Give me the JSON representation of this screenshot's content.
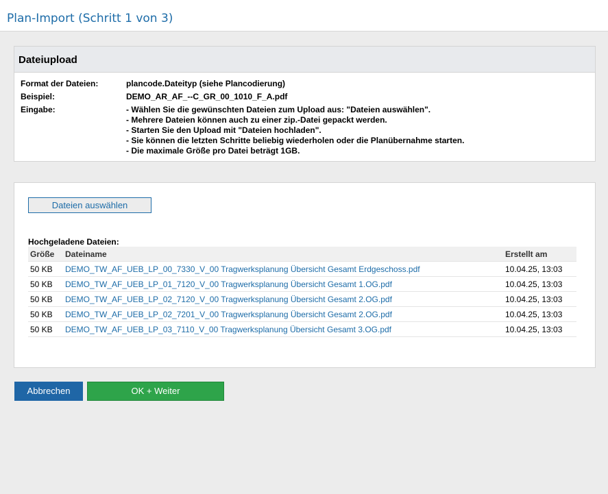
{
  "page": {
    "title": "Plan-Import (Schritt 1 von 3)"
  },
  "info_panel": {
    "title": "Dateiupload",
    "rows": [
      {
        "label": "Format der Dateien:",
        "value": "plancode.Dateityp (siehe Plancodierung)"
      },
      {
        "label": "Beispiel:",
        "value": "DEMO_AR_AF_--C_GR_00_1010_F_A.pdf"
      }
    ],
    "input_label": "Eingabe:",
    "input_lines": [
      "- Wählen Sie die gewünschten Dateien zum Upload aus: \"Dateien auswählen\".",
      "- Mehrere Dateien können auch zu einer zip.-Datei gepackt werden.",
      "- Starten Sie den Upload mit \"Dateien hochladen\".",
      "- Sie können die letzten Schritte beliebig wiederholen oder die Planübernahme starten.",
      "- Die maximale Größe pro Datei beträgt 1GB."
    ]
  },
  "files_panel": {
    "select_button": "Dateien auswählen",
    "uploaded_title": "Hochgeladene Dateien:",
    "columns": {
      "size": "Größe",
      "name": "Dateiname",
      "created": "Erstellt am"
    },
    "files": [
      {
        "size": "50 KB",
        "name": "DEMO_TW_AF_UEB_LP_00_7330_V_00 Tragwerksplanung Übersicht Gesamt Erdgeschoss.pdf",
        "created": "10.04.25, 13:03"
      },
      {
        "size": "50 KB",
        "name": "DEMO_TW_AF_UEB_LP_01_7120_V_00 Tragwerksplanung Übersicht Gesamt 1.OG.pdf",
        "created": "10.04.25, 13:03"
      },
      {
        "size": "50 KB",
        "name": "DEMO_TW_AF_UEB_LP_02_7120_V_00 Tragwerksplanung Übersicht Gesamt 2.OG.pdf",
        "created": "10.04.25, 13:03"
      },
      {
        "size": "50 KB",
        "name": "DEMO_TW_AF_UEB_LP_02_7201_V_00 Tragwerksplanung Übersicht Gesamt 2.OG.pdf",
        "created": "10.04.25, 13:03"
      },
      {
        "size": "50 KB",
        "name": "DEMO_TW_AF_UEB_LP_03_7110_V_00 Tragwerksplanung Übersicht Gesamt 3.OG.pdf",
        "created": "10.04.25, 13:03"
      }
    ]
  },
  "actions": {
    "cancel": "Abbrechen",
    "ok": "OK + Weiter"
  },
  "colors": {
    "accent": "#1d6ca8",
    "ok_green": "#2ea44a",
    "cancel_blue": "#1f66a6"
  }
}
